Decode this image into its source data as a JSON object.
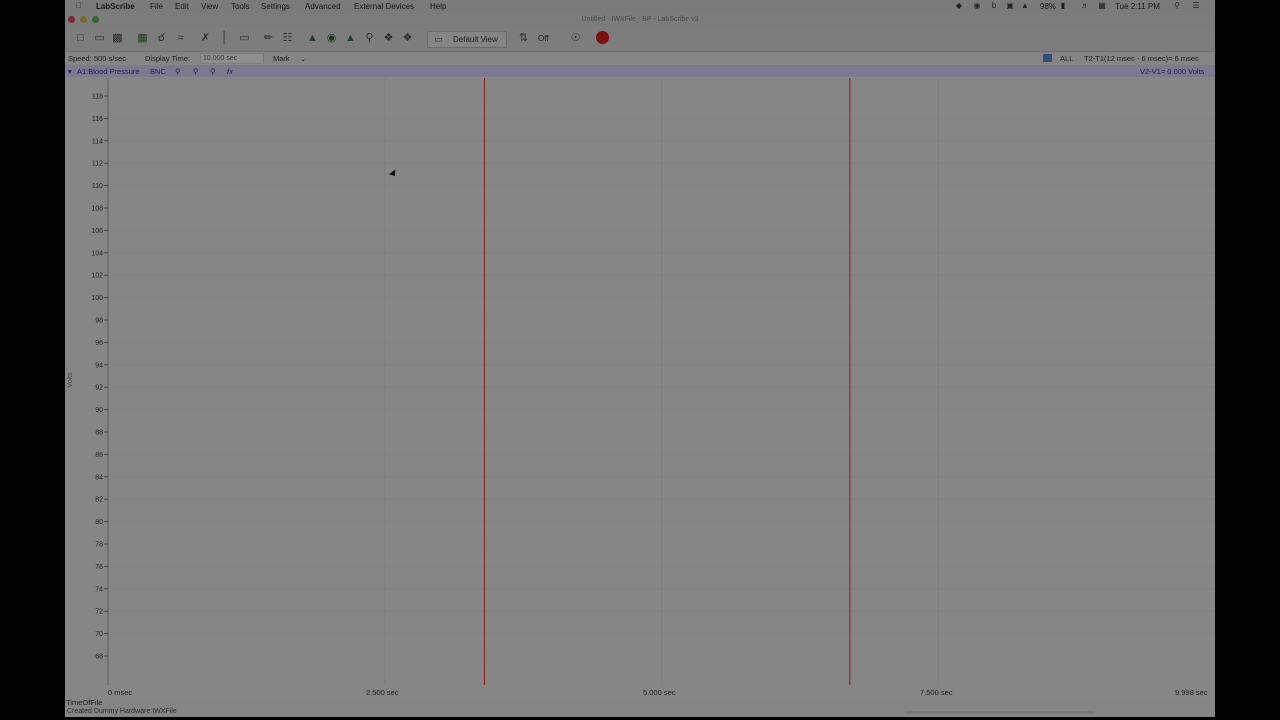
{
  "menubar": {
    "app": "LabScribe",
    "items": [
      "File",
      "Edit",
      "View",
      "Tools",
      "Settings",
      "Advanced",
      "External Devices",
      "Help"
    ],
    "battery": "98%",
    "clock": "Tue 2:11 PM"
  },
  "window": {
    "title": "Untitled - IWXFile - BP - LabScribe v3"
  },
  "toolbar": {
    "view_label": "Default View",
    "mode_label": "Off"
  },
  "infobar": {
    "speed": "Speed: 500 s/sec",
    "display_time_label": "Display Time:",
    "display_time_value": "10.000 sec",
    "mark_label": "Mark",
    "all_label": "ALL",
    "t_readout": "T2-T1(12 msec - 6 msec)= 6 msec"
  },
  "channel": {
    "name": "A1:Blood Pressure",
    "input": "BNC",
    "fx": "fx",
    "v_readout": "V2-V1= 0.000 Volts",
    "ylabel": "Volts",
    "yticks": [
      "118",
      "116",
      "114",
      "112",
      "110",
      "108",
      "106",
      "104",
      "102",
      "100",
      "98",
      "96",
      "94",
      "92",
      "90",
      "88",
      "86",
      "84",
      "82",
      "80",
      "78",
      "76",
      "74",
      "72",
      "70",
      "68"
    ]
  },
  "xaxis": {
    "ticks": [
      "0 msec",
      "2.500 sec",
      "5.000 sec",
      "7.500 sec",
      "9.998 sec"
    ],
    "cursors_sec": [
      3.4,
      6.7
    ],
    "range_sec": [
      0,
      9.998
    ]
  },
  "status": {
    "left": "TimeOfFile",
    "bottom": "Created Dummy Hardware:IWXFile"
  },
  "colors": {
    "cursor_line": "#8a2a2a",
    "record_button": "#7a1010",
    "channel_text": "#1f1d5e"
  }
}
